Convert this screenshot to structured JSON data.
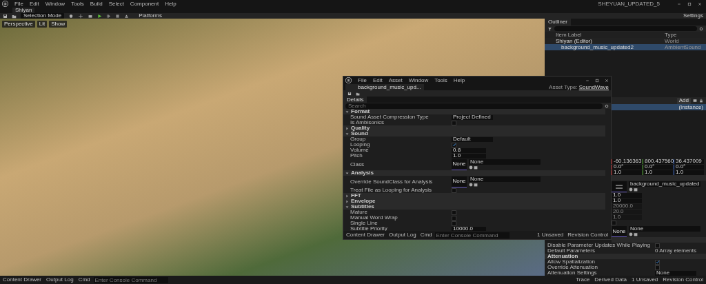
{
  "app": {
    "menu": [
      "File",
      "Edit",
      "Window",
      "Tools",
      "Build",
      "Select",
      "Component",
      "Help"
    ],
    "project_title": "SHEYUAN_UPDATED_5",
    "level_tab": "Shiyan"
  },
  "toolbar": {
    "mode": "Selection Mode",
    "platforms": "Platforms",
    "settings": "Settings"
  },
  "viewport": {
    "view": "Perspective",
    "lighting": "Lit",
    "show": "Show"
  },
  "outliner": {
    "title": "Outliner",
    "columns": [
      "Item Label",
      "Type"
    ],
    "items": [
      {
        "label": "Shiyan (Editor)",
        "type": "World",
        "selected": false,
        "children": [
          {
            "label": "background_music_updated2",
            "type": "AmbientSound",
            "selected": true
          }
        ]
      }
    ]
  },
  "details": {
    "add": "Add",
    "instance": "(Instance)",
    "rows": [
      {
        "kind": "vector3",
        "values": [
          "-60.136363",
          "800.437560",
          "36.437009"
        ]
      },
      {
        "kind": "vector3",
        "values": [
          "0.0°",
          "0.0°",
          "0.0°"
        ]
      },
      {
        "kind": "vector3",
        "values": [
          "1.0",
          "1.0",
          "1.0"
        ]
      },
      {
        "kind": "section"
      },
      {
        "kind": "asset",
        "value": "background_music_updated"
      },
      {
        "kind": "number",
        "value": "1.0",
        "disabled": false
      },
      {
        "kind": "number",
        "value": "1.0",
        "disabled": false
      },
      {
        "kind": "number",
        "value": "20000.0",
        "disabled": true
      },
      {
        "kind": "number",
        "value": "20.0",
        "disabled": true
      },
      {
        "kind": "number",
        "value": "1.0",
        "disabled": true
      },
      {
        "kind": "checkbox",
        "checked": false
      },
      {
        "kind": "asset",
        "value": "None",
        "thumb_label": "None"
      },
      {
        "kind": "section"
      },
      {
        "kind": "checkbox",
        "label": "Disable Parameter Updates While Playing",
        "checked": false
      },
      {
        "kind": "text",
        "label": "Default Parameters",
        "value": "0 Array elements"
      },
      {
        "kind": "section",
        "label": "Attenuation"
      },
      {
        "kind": "checkbox",
        "label": "Allow Spatialization",
        "checked": true
      },
      {
        "kind": "checkbox",
        "label": "Override Attenuation",
        "checked": false
      },
      {
        "kind": "dropdown",
        "label": "Attenuation Settings",
        "value": "None"
      }
    ]
  },
  "sound_editor": {
    "menu": [
      "File",
      "Edit",
      "Asset",
      "Window",
      "Tools",
      "Help"
    ],
    "tab": "background_music_upd...",
    "asset_type_label": "Asset Type:",
    "asset_type": "SoundWave",
    "details_tab": "Details",
    "search_placeholder": "Search",
    "rows": [
      {
        "kind": "section",
        "label": "Format",
        "expanded": true
      },
      {
        "kind": "dropdown",
        "label": "Sound Asset Compression Type",
        "value": "Project Defined"
      },
      {
        "kind": "checkbox",
        "label": "Is Ambisonics",
        "checked": false
      },
      {
        "kind": "section",
        "label": "Quality",
        "expanded": false
      },
      {
        "kind": "section",
        "label": "Sound",
        "expanded": true
      },
      {
        "kind": "dropdown",
        "label": "Group",
        "value": "Default"
      },
      {
        "kind": "checkbox",
        "label": "Looping",
        "checked": true
      },
      {
        "kind": "number",
        "label": "Volume",
        "value": "0.8"
      },
      {
        "kind": "number",
        "label": "Pitch",
        "value": "1.0"
      },
      {
        "kind": "asset",
        "label": "Class",
        "value": "None",
        "thumb_label": "None"
      },
      {
        "kind": "section",
        "label": "Analysis",
        "expanded": true
      },
      {
        "kind": "asset",
        "label": "Override SoundClass for Analysis",
        "value": "None",
        "thumb_label": "None"
      },
      {
        "kind": "checkbox",
        "label": "Treat File as Looping for Analysis",
        "checked": false
      },
      {
        "kind": "section",
        "label": "FFT",
        "expanded": false
      },
      {
        "kind": "section",
        "label": "Envelope",
        "expanded": false
      },
      {
        "kind": "section",
        "label": "Subtitles",
        "expanded": true
      },
      {
        "kind": "checkbox",
        "label": "Mature",
        "checked": false
      },
      {
        "kind": "checkbox",
        "label": "Manual Word Wrap",
        "checked": false
      },
      {
        "kind": "checkbox",
        "label": "Single Line",
        "checked": false
      },
      {
        "kind": "number",
        "label": "Subtitle Priority",
        "value": "10000.0"
      }
    ],
    "status": {
      "content_drawer": "Content Drawer",
      "output_log": "Output Log",
      "cmd": "Cmd",
      "console_placeholder": "Enter Console Command",
      "unsaved": "1 Unsaved",
      "revision": "Revision Control"
    }
  },
  "status_bar": {
    "content_drawer": "Content Drawer",
    "output_log": "Output Log",
    "cmd": "Cmd",
    "console_placeholder": "Enter Console Command",
    "trace": "Trace",
    "derived_data": "Derived Data",
    "unsaved": "1 Unsaved",
    "revision": "Revision Control"
  }
}
